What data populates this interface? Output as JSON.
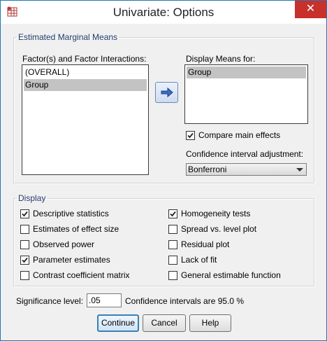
{
  "window": {
    "title": "Univariate: Options",
    "close_glyph": "✕",
    "app_icon": "spss-table-icon"
  },
  "emm": {
    "legend": "Estimated Marginal Means",
    "factors_label": "Factor(s) and Factor Interactions:",
    "factors": [
      {
        "label": "(OVERALL)",
        "selected": false
      },
      {
        "label": "Group",
        "selected": true
      }
    ],
    "move_icon": "arrow-right-icon",
    "display_means_label": "Display Means for:",
    "display_means": [
      {
        "label": "Group",
        "selected": true
      }
    ],
    "compare_main_effects": {
      "label": "Compare main effects",
      "checked": true
    },
    "ci_adjustment_label": "Confidence interval adjustment:",
    "ci_adjustment_value": "Bonferroni"
  },
  "display": {
    "legend": "Display",
    "left": [
      {
        "label": "Descriptive statistics",
        "checked": true
      },
      {
        "label": "Estimates of effect size",
        "checked": false
      },
      {
        "label": "Observed power",
        "checked": false
      },
      {
        "label": "Parameter estimates",
        "checked": true
      },
      {
        "label": "Contrast coefficient matrix",
        "checked": false
      }
    ],
    "right": [
      {
        "label": "Homogeneity tests",
        "checked": true
      },
      {
        "label": "Spread vs. level plot",
        "checked": false
      },
      {
        "label": "Residual plot",
        "checked": false
      },
      {
        "label": "Lack of fit",
        "checked": false
      },
      {
        "label": "General estimable function",
        "checked": false
      }
    ]
  },
  "significance": {
    "label": "Significance level:",
    "value": ".05",
    "ci_note": "Confidence intervals are 95.0 %"
  },
  "buttons": {
    "continue": "Continue",
    "cancel": "Cancel",
    "help": "Help"
  },
  "colors": {
    "legend_text": "#223b6e",
    "close_bg": "#c7302b",
    "selection": "#c3c3c3",
    "default_border": "#3c7fb1"
  }
}
